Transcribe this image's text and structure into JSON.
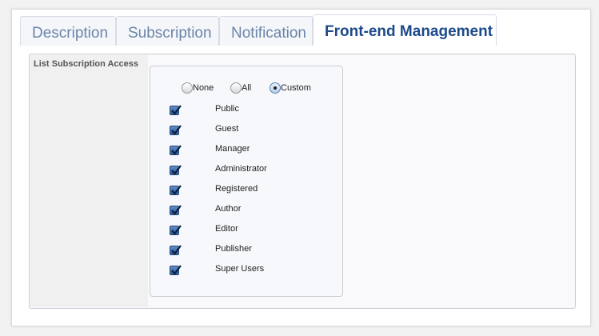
{
  "tabs": [
    {
      "label": "Description",
      "active": false
    },
    {
      "label": "Subscription",
      "active": false
    },
    {
      "label": "Notification",
      "active": false
    },
    {
      "label": "Front-end Management",
      "active": true
    }
  ],
  "field": {
    "label": "List Subscription Access"
  },
  "access_mode": {
    "options": [
      {
        "label": "None",
        "checked": false
      },
      {
        "label": "All",
        "checked": false
      },
      {
        "label": "Custom",
        "checked": true
      }
    ]
  },
  "groups": [
    {
      "label": "Public",
      "checked": true
    },
    {
      "label": "Guest",
      "checked": true
    },
    {
      "label": "Manager",
      "checked": true
    },
    {
      "label": "Administrator",
      "checked": true
    },
    {
      "label": "Registered",
      "checked": true
    },
    {
      "label": "Author",
      "checked": true
    },
    {
      "label": "Editor",
      "checked": true
    },
    {
      "label": "Publisher",
      "checked": true
    },
    {
      "label": "Super Users",
      "checked": true
    }
  ],
  "colors": {
    "tab_active_text": "#1d4a8a",
    "tab_inactive_text": "#6b85a8",
    "checkbox_fill": "#2e5d9b"
  }
}
